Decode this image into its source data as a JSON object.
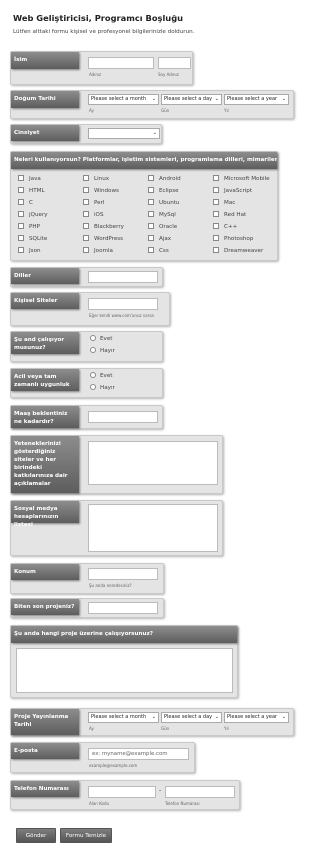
{
  "header": {
    "title": "Web Geliştiricisi, Programcı Boşluğu",
    "subtitle": "Lütfen alttaki formu kişisel ve profesyonel bilgilerinizle doldurun."
  },
  "name": {
    "label": "İsim",
    "first_sub": "Adınız",
    "last_sub": "Soy Adınız",
    "first_value": "",
    "last_value": ""
  },
  "birth": {
    "label": "Doğum Tarihi",
    "month": "Please select a month",
    "day": "Please select a day",
    "year": "Please select a year",
    "month_sub": "Ay",
    "day_sub": "Gün",
    "year_sub": "Yıl"
  },
  "gender": {
    "label": "Cinsiyet",
    "value": ""
  },
  "skills": {
    "label": "Neleri kullanıyorsun? Platformlar, işletim sistemleri, programlama dilleri, mimariler, vs...",
    "columns": [
      [
        "Java",
        "HTML",
        "C",
        "jQuery",
        "PHP",
        "SQLite",
        "Json"
      ],
      [
        "Linux",
        "Windows",
        "Perl",
        "iOS",
        "Blackberry",
        "WordPress",
        "Joomla"
      ],
      [
        "Android",
        "Eclipse",
        "Ubuntu",
        "MySql",
        "Oracle",
        "Ajax",
        "Css"
      ],
      [
        "Microsoft Mobile",
        "JavaScript",
        "Mac",
        "Red Hat",
        "C++",
        "Photoshop",
        "Dreamweaver"
      ]
    ]
  },
  "languages": {
    "label": "Diller",
    "value": ""
  },
  "personal_sites": {
    "label": "Kişisel Siteler",
    "value": "",
    "sub": "Eğer kendi www.com'unuz varsa"
  },
  "working": {
    "label": "Şu and çalışıyor musunuz?",
    "options": [
      "Evet",
      "Hayır"
    ]
  },
  "fulltime": {
    "label": "Acil veya tam zamanlı uygunluk",
    "options": [
      "Evet",
      "Hayır"
    ]
  },
  "salary": {
    "label": "Maaş beklentiniz ne kadardır?",
    "value": ""
  },
  "abilities": {
    "label": "Yeteneklerinizi gösterdiğiniz siteler ve her birindeki katkılarınıza dair açıklamalar"
  },
  "social": {
    "label": "Sosyal medya hesaplarınızın listesi"
  },
  "location": {
    "label": "Konum",
    "value": "",
    "sub": "Şu anda neredesiniz?"
  },
  "last_project": {
    "label": "Biten son projeniz?",
    "value": ""
  },
  "current_project": {
    "label": "Şu anda hangi proje üzerine çalışıyorsunuz?"
  },
  "release": {
    "label": "Proje Yayınlanma Tarihi",
    "month": "Please select a month",
    "day": "Please select a day",
    "year": "Please select a year",
    "month_sub": "Ay",
    "day_sub": "Gün",
    "year_sub": "Yıl"
  },
  "email": {
    "label": "E-posta",
    "placeholder": "ex: myname@example.com",
    "sub": "example@example.com"
  },
  "phone": {
    "label": "Telefon Numarası",
    "area_sub": "Alan Kodu",
    "number_sub": "Telefon Numarası",
    "dash": "-"
  },
  "buttons": {
    "submit": "Gönder",
    "reset": "Formu Temizle"
  }
}
